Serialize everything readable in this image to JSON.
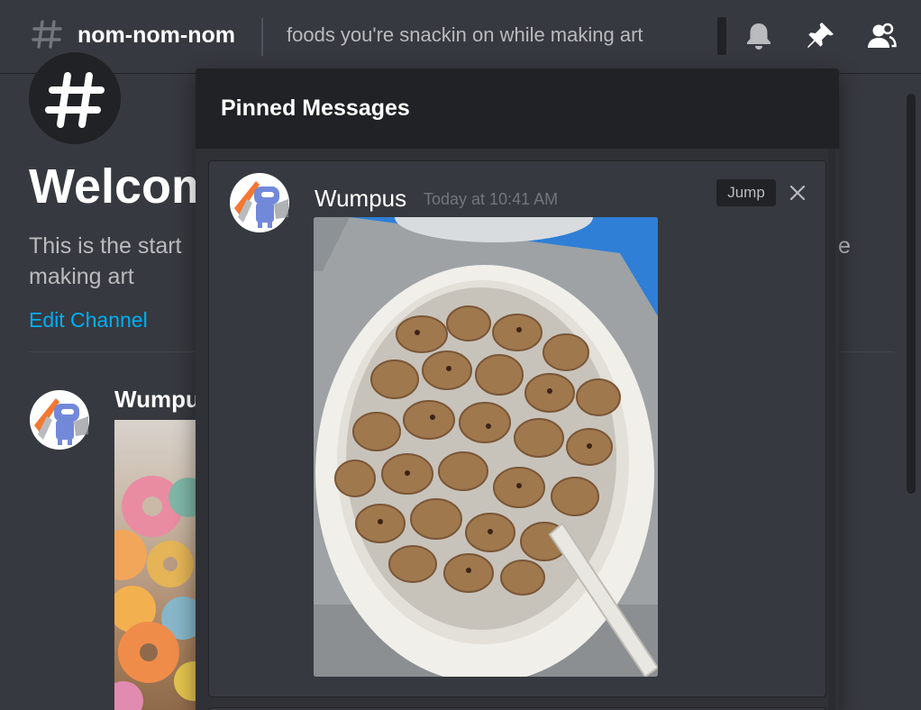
{
  "header": {
    "channel_name": "nom-nom-nom",
    "topic": "foods you're snackin on while making art",
    "icons": [
      "hash-icon",
      "bell-icon",
      "pin-icon",
      "members-icon"
    ]
  },
  "welcome": {
    "title": "Welcom",
    "description_line1": "This is the start",
    "description_tail": "e",
    "description_line2": "making art",
    "edit_channel": "Edit Channel"
  },
  "background_message": {
    "username": "Wumpu"
  },
  "pinned": {
    "title": "Pinned Messages",
    "message": {
      "username": "Wumpus",
      "timestamp": "Today at 10:41 AM",
      "jump_label": "Jump",
      "image_alt": "cereal-bowl-photo"
    }
  },
  "colors": {
    "background": "#36393f",
    "popout": "#2f3136",
    "header": "#202225",
    "link": "#00aff4",
    "wumpus_blue": "#7289da"
  }
}
